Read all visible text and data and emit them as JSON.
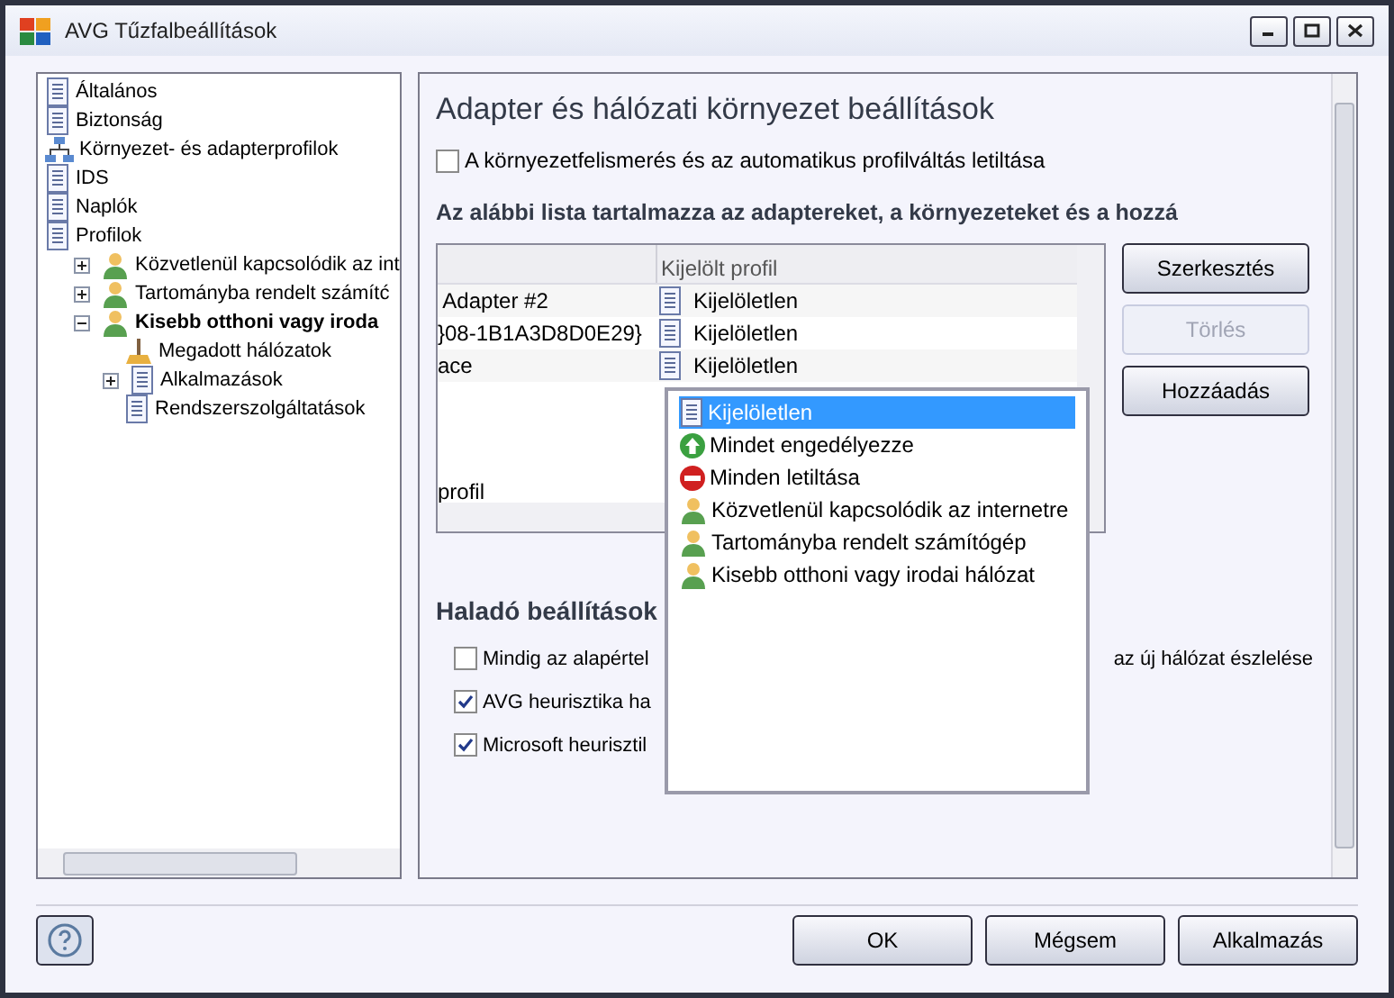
{
  "window": {
    "title": "AVG Tűzfalbeállítások"
  },
  "tree": [
    {
      "label": "Általános",
      "kind": "doc",
      "selected": false
    },
    {
      "label": "Biztonság",
      "kind": "doc",
      "selected": false
    },
    {
      "label": "Környezet- és adapterprofilok",
      "kind": "network",
      "selected": false
    },
    {
      "label": "IDS",
      "kind": "doc",
      "selected": false
    },
    {
      "label": "Naplók",
      "kind": "doc",
      "selected": false
    },
    {
      "label": "Profilok",
      "kind": "doc",
      "selected": false,
      "children": [
        {
          "label": "Közvetlenül kapcsolódik az int",
          "kind": "person",
          "selected": false,
          "expanded": false
        },
        {
          "label": "Tartományba rendelt számítć",
          "kind": "person",
          "selected": false,
          "expanded": false
        },
        {
          "label": "Kisebb otthoni vagy iroda",
          "kind": "person",
          "selected": true,
          "expanded": true,
          "children": [
            {
              "label": "Megadott hálózatok",
              "kind": "tool",
              "selected": false
            },
            {
              "label": "Alkalmazások",
              "kind": "doc",
              "selected": false,
              "expanded": false
            },
            {
              "label": "Rendszerszolgáltatások",
              "kind": "doc",
              "selected": false
            }
          ]
        }
      ]
    }
  ],
  "panel": {
    "title": "Adapter és hálózati környezet beállítások",
    "disable_checkbox": {
      "label": "A környezetfelismerés és az automatikus profilváltás letiltása",
      "checked": false
    },
    "list_heading": "Az alábbi lista tartalmazza az adaptereket, a környezeteket és a hozzá",
    "table": {
      "columns": [
        "Kijelölt profil"
      ],
      "rows": [
        {
          "column_1": " Adapter #2",
          "profile": "Kijelöletlen"
        },
        {
          "column_1": "}08-1B1A3D8D0E29}",
          "profile": "Kijelöletlen"
        },
        {
          "column_1": "ace",
          "profile": "Kijelöletlen"
        },
        {
          "column_1": "profil"
        }
      ]
    },
    "buttons": [
      {
        "label": "Szerkesztés",
        "disabled": false
      },
      {
        "label": "Törlés",
        "disabled": true
      },
      {
        "label": "Hozzáadás",
        "disabled": false
      }
    ],
    "dropdown": [
      {
        "label": "Kijelöletlen",
        "kind": "unassigned",
        "selected": true
      },
      {
        "label": "Mindet engedélyezze",
        "kind": "allow",
        "selected": false
      },
      {
        "label": "Minden letiltása",
        "kind": "block",
        "selected": false
      },
      {
        "label": "Közvetlenül kapcsolódik az internetre",
        "kind": "profile",
        "selected": false
      },
      {
        "label": "Tartományba rendelt számítógép",
        "kind": "profile",
        "selected": false
      },
      {
        "label": "Kisebb otthoni vagy irodai hálózat",
        "kind": "profile",
        "selected": false
      }
    ],
    "advanced_heading": "Haladó beállítások",
    "advanced": [
      {
        "label": "Mindig az alapértel",
        "label_end": "az új hálózat észlelése",
        "checked": false
      },
      {
        "label": "AVG heurisztika ha",
        "checked": true
      },
      {
        "label": "Microsoft heurisztil",
        "checked": true
      }
    ]
  },
  "footer_buttons": [
    "OK",
    "Mégsem",
    "Alkalmazás"
  ]
}
